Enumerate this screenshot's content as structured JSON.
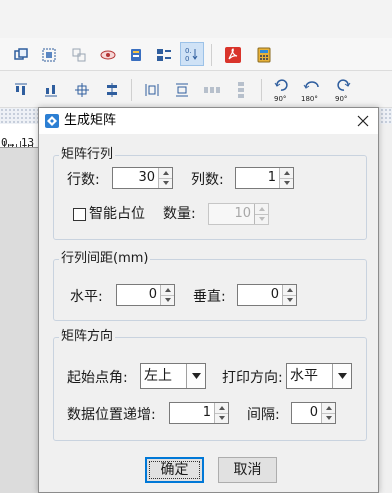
{
  "background": {
    "ruler_text": "0… 13",
    "toolbar1_icons": [
      "group-icon",
      "align-icon",
      "ungroup-icon",
      "eye-icon",
      "layer-icon",
      "arrange-icon",
      "matrix-icon",
      "pdf-icon",
      "calculator-icon"
    ],
    "toolbar2_icons": [
      "align-top-icon",
      "align-bottom-icon",
      "center-h-icon",
      "center-v-icon",
      "distribute-h-icon",
      "distribute-v-icon",
      "distribute-x-icon",
      "distribute-y-icon"
    ],
    "rotate_labels": [
      "90°",
      "180°",
      "90°"
    ]
  },
  "dialog": {
    "title": "生成矩阵",
    "matrix_rowcol": {
      "legend": "矩阵行列",
      "rows_label": "行数:",
      "rows_value": "30",
      "cols_label": "列数:",
      "cols_value": "1",
      "smart_label": "智能占位",
      "smart_checked": false,
      "count_label": "数量:",
      "count_value": "10"
    },
    "spacing": {
      "legend": "行列间距(mm)",
      "horizontal_label": "水平:",
      "horizontal_value": "0",
      "vertical_label": "垂直:",
      "vertical_value": "0"
    },
    "direction": {
      "legend": "矩阵方向",
      "start_label": "起始点角:",
      "start_value": "左上",
      "print_dir_label": "打印方向:",
      "print_dir_value": "水平",
      "increment_label": "数据位置递增:",
      "increment_value": "1",
      "interval_label": "间隔:",
      "interval_value": "0"
    },
    "ok_label": "确定",
    "cancel_label": "取消"
  }
}
